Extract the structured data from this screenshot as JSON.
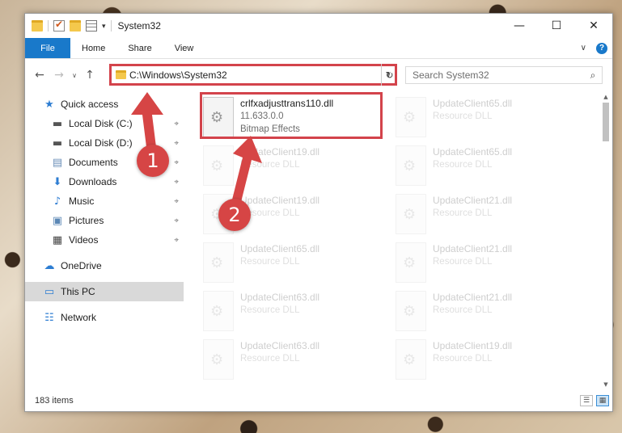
{
  "titlebar": {
    "title": "System32",
    "qa_dropdown": "▾",
    "minimize": "—",
    "maximize": "☐",
    "close": "✕"
  },
  "ribbon": {
    "file_label": "File",
    "tabs": [
      "Home",
      "Share",
      "View"
    ],
    "expand": "∨",
    "help": "?"
  },
  "navigation": {
    "back": "←",
    "forward": "→",
    "recent": "∨",
    "up": "↑",
    "address": "C:\\Windows\\System32",
    "address_dropdown": "∨",
    "refresh": "↻",
    "search_placeholder": "Search System32",
    "search_icon_glyph": "⌕"
  },
  "sidebar": {
    "items": [
      {
        "label": "Quick access",
        "icon": "star-icon",
        "glyph": "★",
        "color": "#2d7dd2"
      },
      {
        "label": "Local Disk (C:)",
        "icon": "drive-icon",
        "glyph": "▬",
        "color": "#555555",
        "pinned": true
      },
      {
        "label": "Local Disk (D:)",
        "icon": "drive-icon",
        "glyph": "▬",
        "color": "#555555",
        "pinned": true
      },
      {
        "label": "Documents",
        "icon": "documents-icon",
        "glyph": "▤",
        "color": "#6b8fb8",
        "pinned": true
      },
      {
        "label": "Downloads",
        "icon": "download-icon",
        "glyph": "⬇",
        "color": "#2d7dd2",
        "pinned": true
      },
      {
        "label": "Music",
        "icon": "music-icon",
        "glyph": "♪",
        "color": "#2d7dd2",
        "pinned": true
      },
      {
        "label": "Pictures",
        "icon": "pictures-icon",
        "glyph": "▣",
        "color": "#5b87b5",
        "pinned": true
      },
      {
        "label": "Videos",
        "icon": "video-icon",
        "glyph": "▦",
        "color": "#444444",
        "pinned": true
      },
      {
        "label": "OneDrive",
        "icon": "cloud-icon",
        "glyph": "☁",
        "color": "#2d7dd2"
      },
      {
        "label": "This PC",
        "icon": "computer-icon",
        "glyph": "▭",
        "color": "#2d7dd2"
      },
      {
        "label": "Network",
        "icon": "network-icon",
        "glyph": "☷",
        "color": "#2d7dd2"
      }
    ],
    "pin_glyph": "⌖"
  },
  "files": {
    "highlighted": {
      "name": "crlfxadjusttrans110.dll",
      "version": "11.633.0.0",
      "description": "Bitmap Effects"
    },
    "right_column": [
      {
        "name": "UpdateClient65.dll",
        "type": "Resource DLL"
      },
      {
        "name": "UpdateClient65.dll",
        "type": "Resource DLL"
      },
      {
        "name": "UpdateClient21.dll",
        "type": "Resource DLL"
      },
      {
        "name": "UpdateClient21.dll",
        "type": "Resource DLL"
      },
      {
        "name": "UpdateClient21.dll",
        "type": "Resource DLL"
      },
      {
        "name": "UpdateClient19.dll",
        "type": "Resource DLL"
      }
    ],
    "left_column": [
      {
        "name": "UpdateClient19.dll",
        "type": "Resource DLL"
      },
      {
        "name": "UpdateClient19.dll",
        "type": "Resource DLL"
      },
      {
        "name": "UpdateClient65.dll",
        "type": "Resource DLL"
      },
      {
        "name": "UpdateClient63.dll",
        "type": "Resource DLL"
      },
      {
        "name": "UpdateClient63.dll",
        "type": "Resource DLL"
      }
    ]
  },
  "status": {
    "item_count": "183 items",
    "details_view": "☰",
    "tiles_view": "▦"
  },
  "annotations": {
    "callout_1": "1",
    "callout_2": "2",
    "color": "#d64545"
  },
  "scrollbar": {
    "up": "▲",
    "down": "▼"
  }
}
